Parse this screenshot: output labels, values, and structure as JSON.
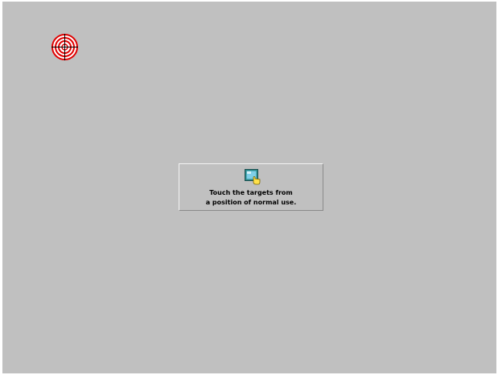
{
  "calibration": {
    "target_icon": "crosshair-target-icon",
    "target_color": "#e00000",
    "background_color": "#c0c0c0",
    "instruction_icon": "touch-screen-icon",
    "instruction_lines": [
      "Touch the targets from",
      "a position of normal use."
    ]
  }
}
